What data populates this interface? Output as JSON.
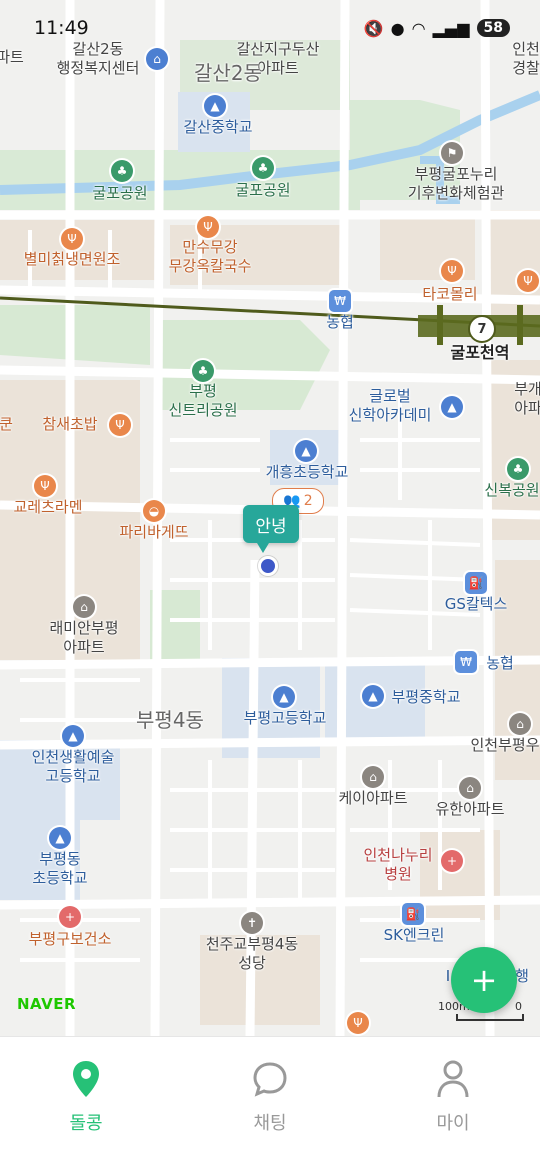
{
  "status_bar": {
    "time": "11:49",
    "battery": "58"
  },
  "map": {
    "labels": {
      "top_left_apt": "파트",
      "galsan2_center": "갈산2동\n행정복지센터",
      "galsan_apt": "갈산지구두산\n아파트",
      "incheon_police": "인천\n경찰",
      "galsan2_area": "갈산2동",
      "galsan_middle": "갈산중학교",
      "gulpo_park_left": "굴포공원",
      "gulpo_park_mid": "굴포공원",
      "gulpo_climate": "부평굴포누리\n기후변화체험관",
      "byeolmi": "별미칡냉면원조",
      "mansu": "만수무강\n무강옥칼국수",
      "takomolli": "타코몰리",
      "nonghyup_top": "농협",
      "gulpocheon": "굴포천역",
      "bupyeong_apt_right": "부개\n아파",
      "sintree_park": "부평\n신트리공원",
      "global_academy": "글로벌\n신학아카데미",
      "left_edge": "쿤",
      "chamsae": "참새초밥",
      "gaeheung": "개흥초등학교",
      "sinbok": "신복공원",
      "gore": "교레츠라멘",
      "paris": "파리바게뜨",
      "gs": "GS칼텍스",
      "raemian": "래미안부평\n아파트",
      "nonghyup_mid": "농협",
      "bupyeong4": "부평4동",
      "bupyeong_high": "부평고등학교",
      "bupyeong_middle": "부평중학교",
      "incheon_bupyeong": "인천부평우",
      "incheon_arts": "인천생활예술\n고등학교",
      "kei_apt": "케이아파트",
      "yuhan_apt": "유한아파트",
      "bupyeong_elem": "부평동\n초등학교",
      "nanuri": "인천나누리\n병원",
      "health": "부평구보건소",
      "sk": "SK엔크린",
      "cathedral": "천주교부평4동\n성당",
      "bottom_right": "I",
      "bottom_right2": "행"
    },
    "pin": {
      "label": "안녕",
      "count": "2"
    },
    "station_number": "7",
    "attribution": "NAVER",
    "scale": {
      "left": "100m",
      "right": "0"
    }
  },
  "fab": {
    "icon": "plus-icon",
    "label": "+"
  },
  "tabs": [
    {
      "label": "돌콩",
      "icon": "location-pin-icon",
      "active": true
    },
    {
      "label": "채팅",
      "icon": "chat-bubble-icon",
      "active": false
    },
    {
      "label": "마이",
      "icon": "person-icon",
      "active": false
    }
  ],
  "colors": {
    "accent": "#26c177",
    "pin": "#27a79a",
    "rail": "#4f5b1c"
  }
}
